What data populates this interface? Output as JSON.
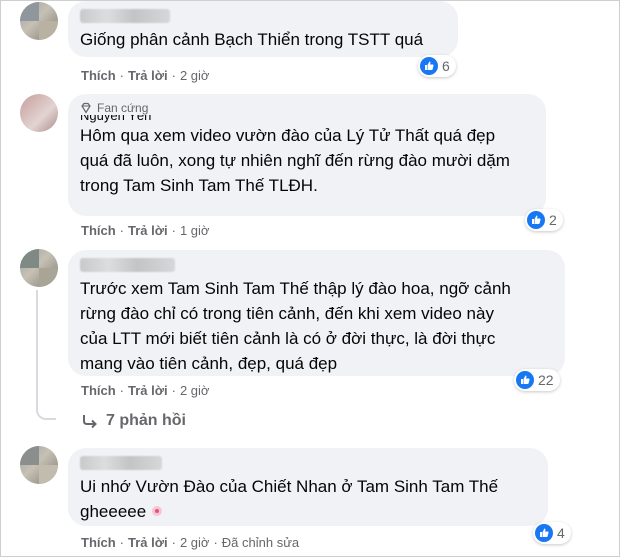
{
  "accent_color": "#1877f2",
  "comments": [
    {
      "text": "Giống phân cảnh Bạch Thiển trong TSTT quá",
      "actions": {
        "like": "Thích",
        "reply": "Trả lời",
        "time": "2 giờ"
      },
      "reaction_count": "6"
    },
    {
      "badge": "Fan cứng",
      "name_fragment": "Nguyễn Yến",
      "text": "Hôm qua xem video vườn đào của Lý Tử Thất quá đẹp\nquá đã luôn, xong tự nhiên nghĩ đến rừng đào mười dặm\ntrong Tam Sinh Tam Thế TLĐH.",
      "actions": {
        "like": "Thích",
        "reply": "Trả lời",
        "time": "1 giờ"
      },
      "reaction_count": "2"
    },
    {
      "text": "Trước xem Tam Sinh Tam Thế thập lý đào hoa, ngỡ cảnh\nrừng đào chỉ có trong tiên cảnh, đến khi xem video này\ncủa LTT mới biết tiên cảnh là có ở đời thực, là đời thực\nmang vào tiên cảnh, đẹp, quá đẹp",
      "actions": {
        "like": "Thích",
        "reply": "Trả lời",
        "time": "2 giờ"
      },
      "reaction_count": "22",
      "replies_label": "7 phản hồi"
    },
    {
      "text": "Ui nhớ Vườn Đào của Chiết Nhan ở Tam Sinh Tam Thế\ngheeeee",
      "actions": {
        "like": "Thích",
        "reply": "Trả lời",
        "time": "2 giờ",
        "edited": "Đã chỉnh sửa"
      },
      "reaction_count": "4"
    }
  ]
}
